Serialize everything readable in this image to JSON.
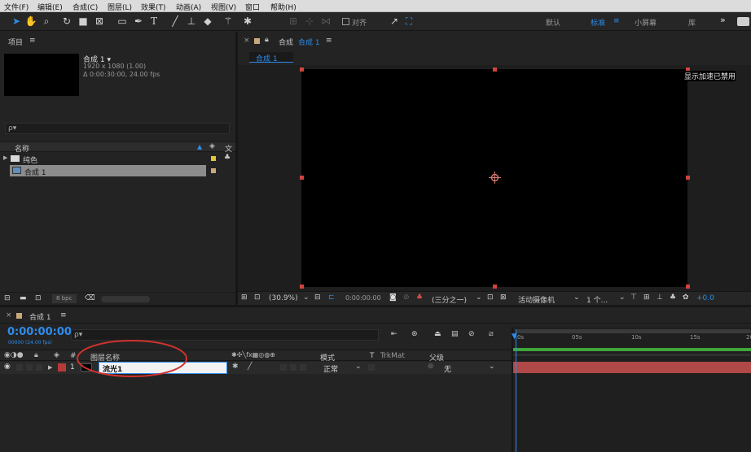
{
  "menu": [
    "文件(F)",
    "编辑(E)",
    "合成(C)",
    "图层(L)",
    "效果(T)",
    "动画(A)",
    "视图(V)",
    "窗口",
    "帮助(H)"
  ],
  "toolbar": {
    "align_label": "对齐",
    "workspaces": [
      "默认",
      "标准",
      "小屏幕",
      "库"
    ],
    "active_workspace": "标准",
    "more": "»"
  },
  "project": {
    "title": "项目",
    "menu_icon": "≡",
    "comp_name": "合成 1 ▾",
    "comp_size": "1920 x 1080 (1.00)",
    "comp_duration": "Δ 0:00:30:00, 24.00 fps",
    "search_placeholder": "ρ▾",
    "col_name": "名称",
    "col_type": "文",
    "items": [
      {
        "label": "纯色",
        "kind": "folder",
        "tag_color": "#e2c43a"
      },
      {
        "label": "合成 1",
        "kind": "comp",
        "tag_color": "#c9a97a",
        "selected": true
      }
    ],
    "bpc": "8 bpc"
  },
  "composition": {
    "tab_title": "合成",
    "tab_name": "合成 1",
    "menu_icon": "≡",
    "sub_tab": "合成 1",
    "gpu_notice": "显示加速已禁用",
    "zoom": "(30.9%)",
    "timecode": "0:00:00:00",
    "resolution": "(三分之一)",
    "camera": "活动摄像机",
    "views": "1 个...",
    "exposure": "+0.0"
  },
  "timeline": {
    "tab_title": "合成 1",
    "menu_icon": "≡",
    "current_time": "0:00:00:00",
    "frame_info": "00000 (24.00 fps)",
    "search_placeholder": "ρ▾",
    "col_layer_name": "图层名称",
    "col_mode": "模式",
    "col_t": "T",
    "col_trkmat": "TrkMat",
    "col_parent": "父级",
    "col_hash": "#",
    "layers": [
      {
        "index": "1",
        "name": "流光1",
        "mode": "正常",
        "parent": "无",
        "label_color": "#b73a3a"
      }
    ],
    "ruler": [
      "0s",
      "05s",
      "10s",
      "15s",
      "20"
    ],
    "track_color": "#b04848",
    "accent_color": "#2d8ceb"
  }
}
